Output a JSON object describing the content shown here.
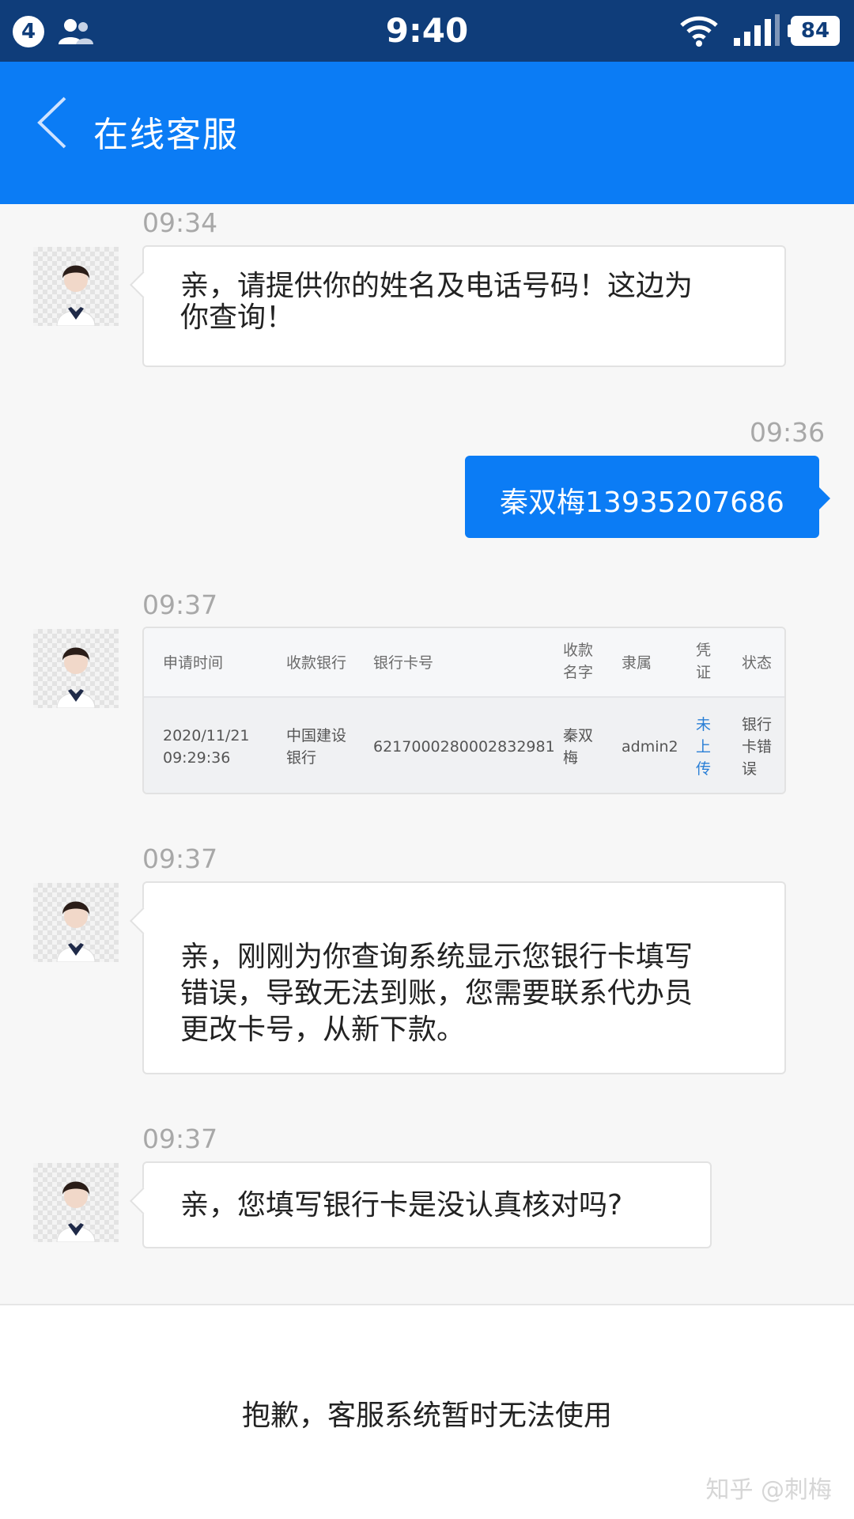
{
  "status_bar": {
    "notification_count": "4",
    "time": "9:40",
    "battery": "84"
  },
  "header": {
    "back_icon": "chevron-left-icon",
    "title": "在线客服"
  },
  "messages": [
    {
      "time": "09:34",
      "sender": "agent",
      "lines": [
        "亲，请提供你的姓名及电话号码！这边为",
        "你查询！"
      ]
    },
    {
      "time": "09:36",
      "sender": "user",
      "text": "秦双梅13935207686"
    },
    {
      "time": "09:37",
      "sender": "agent",
      "type": "table"
    },
    {
      "time": "09:37",
      "sender": "agent",
      "lines": [
        "亲，刚刚为你查询系统显示您银行卡填写",
        "错误，导致无法到账，您需要联系代办员",
        "更改卡号，从新下款。"
      ]
    },
    {
      "time": "09:37",
      "sender": "agent",
      "lines": [
        "亲，您填写银行卡是没认真核对吗?"
      ]
    }
  ],
  "record_table": {
    "headers": [
      "申请时间",
      "收款银行",
      "银行卡号",
      "收款",
      "名字",
      "隶属",
      "凭",
      "证",
      "状态"
    ],
    "row": {
      "date": "2020/11/21",
      "clock": "09:29:36",
      "bank_l1": "中国建设",
      "bank_l2": "银行",
      "card": "6217000280002832981",
      "name_l1": "秦双",
      "name_l2": "梅",
      "belong": "admin2",
      "voucher_l1": "未",
      "voucher_l2": "上",
      "voucher_l3": "传",
      "status_l1": "银行",
      "status_l2": "卡错",
      "status_l3": "误"
    }
  },
  "footer": {
    "message": "抱歉，客服系统暂时无法使用",
    "watermark": "知乎 @刺梅"
  },
  "colors": {
    "status_bar": "#0f3d7a",
    "header": "#0b7cf5",
    "user_bubble": "#0b7cf5",
    "link": "#2a7fd6"
  }
}
